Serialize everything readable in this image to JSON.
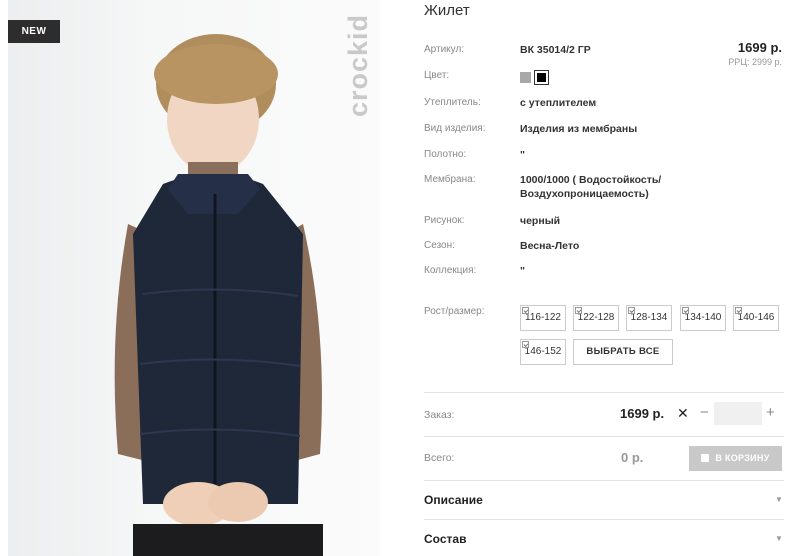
{
  "badge": {
    "new": "NEW"
  },
  "brand": {
    "logo_text": "crockid"
  },
  "product": {
    "title": "Жилет",
    "price": "1699 р.",
    "rrp": "РРЦ: 2999 р."
  },
  "attributes": [
    {
      "label": "Артикул:",
      "value": "ВК 35014/2 ГР"
    },
    {
      "label": "Цвет:",
      "value": ""
    },
    {
      "label": "Утеплитель:",
      "value": "с утеплителем"
    },
    {
      "label": "Вид изделия:",
      "value": "Изделия из мембраны"
    },
    {
      "label": "Полотно:",
      "value": "\""
    },
    {
      "label": "Мембрана:",
      "value_line1": "1000/1000 ( Водостойкость/",
      "value_line2": "Воздухопроницаемость)"
    },
    {
      "label": "Рисунок:",
      "value": "черный"
    },
    {
      "label": "Сезон:",
      "value": "Весна-Лето"
    },
    {
      "label": "Коллекция:",
      "value": "\""
    }
  ],
  "colors": [
    {
      "name": "gray-swatch",
      "hex": "#a8a8a8"
    },
    {
      "name": "black-swatch",
      "hex": "#000000",
      "selected": true
    }
  ],
  "sizes": {
    "label": "Рост/размер:",
    "options": [
      "116-122",
      "122-128",
      "128-134",
      "134-140",
      "140-146",
      "146-152"
    ],
    "select_all": "ВЫБРАТЬ ВСЕ"
  },
  "order": {
    "label": "Заказ:",
    "price": "1699 р.",
    "times": "✕",
    "minus": "−",
    "plus": "+",
    "quantity": ""
  },
  "total": {
    "label": "Всего:",
    "value": "0 р.",
    "cart_button": "В КОРЗИНУ"
  },
  "accordion": [
    {
      "label": "Описание",
      "arrow": "▼"
    },
    {
      "label": "Состав",
      "arrow": "▼"
    }
  ]
}
